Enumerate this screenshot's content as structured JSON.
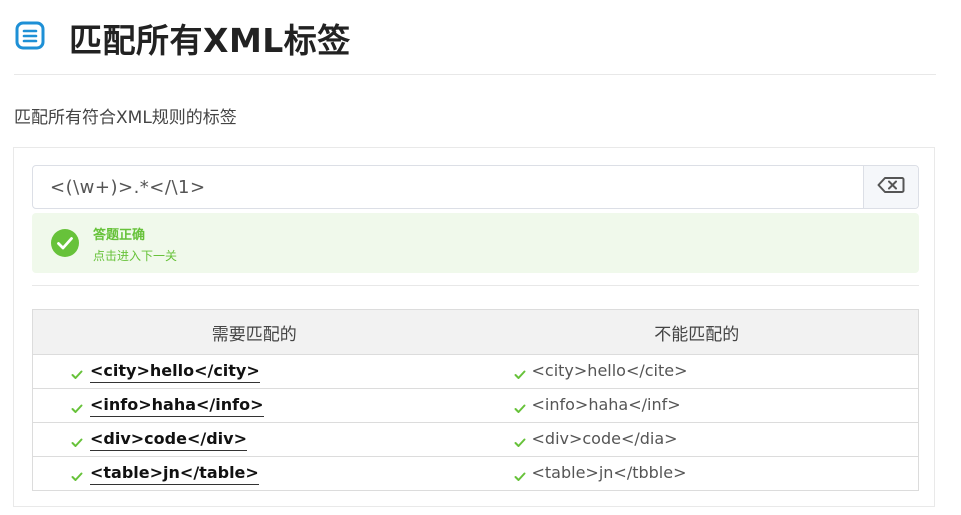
{
  "header": {
    "icon": "list-document-icon",
    "title": "匹配所有XML标签"
  },
  "subtitle": "匹配所有符合XML规则的标签",
  "regex": {
    "value": "<(\\w+)>.*</\\1>",
    "clear_icon": "backspace-icon"
  },
  "alert": {
    "icon": "check-circle-icon",
    "title": "答题正确",
    "description": "点击进入下一关",
    "color": "#67c23a"
  },
  "table": {
    "headers": [
      "需要匹配的",
      "不能匹配的"
    ],
    "rows": [
      {
        "match": "<city>hello</city>",
        "nomatch": "<city>hello</cite>"
      },
      {
        "match": "<info>haha</info>",
        "nomatch": "<info>haha</inf>"
      },
      {
        "match": "<div>code</div>",
        "nomatch": "<div>code</dia>"
      },
      {
        "match": "<table>jn</table>",
        "nomatch": "<table>jn</tbble>"
      }
    ],
    "check_icon": "checkmark-icon",
    "check_color": "#67c23a"
  }
}
